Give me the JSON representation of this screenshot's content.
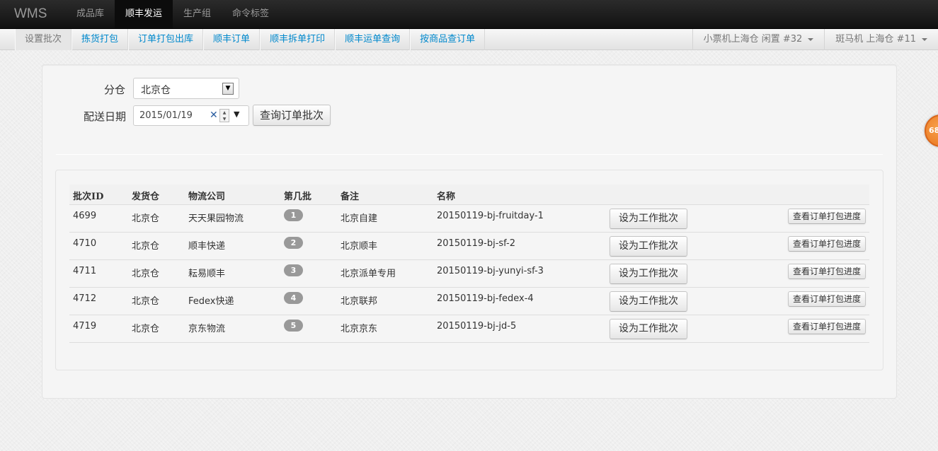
{
  "app": {
    "brand": "WMS"
  },
  "topnav": [
    "成品库",
    "顺丰发运",
    "生产组",
    "命令标签"
  ],
  "subnav": [
    "设置批次",
    "拣货打包",
    "订单打包出库",
    "顺丰订单",
    "顺丰拆单打印",
    "顺丰运单查询",
    "按商品查订单"
  ],
  "printers": [
    {
      "label": "小票机上海仓 闲置 #32"
    },
    {
      "label": "斑马机 上海仓 #11"
    }
  ],
  "form": {
    "warehouse_label": "分仓",
    "warehouse_value": "北京仓",
    "date_label": "配送日期",
    "date_value": "2015/01/19",
    "query_button": "查询订单批次"
  },
  "table": {
    "headers": [
      "批次ID",
      "发货仓",
      "物流公司",
      "第几批",
      "备注",
      "名称"
    ],
    "set_button": "设为工作批次",
    "progress_button": "查看订单打包进度",
    "rows": [
      {
        "id": "4699",
        "warehouse": "北京仓",
        "carrier": "天天果园物流",
        "batch": "1",
        "note": "北京自建",
        "name": "20150119-bj-fruitday-1"
      },
      {
        "id": "4710",
        "warehouse": "北京仓",
        "carrier": "顺丰快递",
        "batch": "2",
        "note": "北京顺丰",
        "name": "20150119-bj-sf-2"
      },
      {
        "id": "4711",
        "warehouse": "北京仓",
        "carrier": "耘易顺丰",
        "batch": "3",
        "note": "北京派单专用",
        "name": "20150119-bj-yunyi-sf-3"
      },
      {
        "id": "4712",
        "warehouse": "北京仓",
        "carrier": "Fedex快递",
        "batch": "4",
        "note": "北京联邦",
        "name": "20150119-bj-fedex-4"
      },
      {
        "id": "4719",
        "warehouse": "北京仓",
        "carrier": "京东物流",
        "batch": "5",
        "note": "北京京东",
        "name": "20150119-bj-jd-5"
      }
    ]
  },
  "floating_badge": "68",
  "colors": {
    "link": "#0088cc",
    "topbar": "#1b1b1b",
    "badge": "#999999",
    "accent_orange": "#e8711a"
  }
}
